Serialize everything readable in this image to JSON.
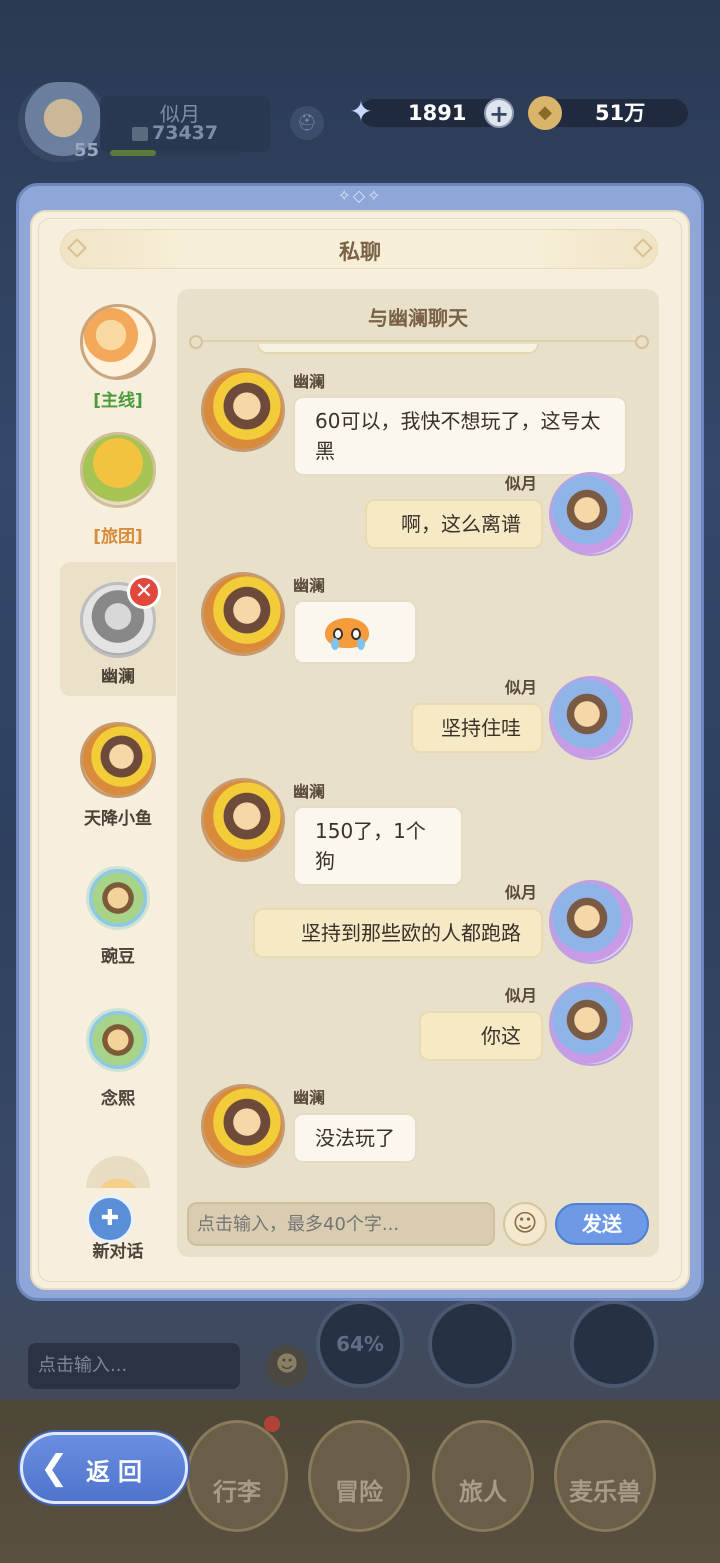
{
  "hud": {
    "player_name": "似月",
    "power": "73437",
    "level": "55",
    "exp_fraction": 0.35,
    "gems": "1891",
    "coins": "51万"
  },
  "dialog": {
    "title": "私聊",
    "chat_title": "与幽澜聊天"
  },
  "contacts": [
    {
      "label": "[主线]"
    },
    {
      "label": "[旅团]"
    },
    {
      "label": "幽澜"
    },
    {
      "label": "天降小鱼"
    },
    {
      "label": "豌豆"
    },
    {
      "label": "念熙"
    }
  ],
  "new_chat_label": "新对话",
  "messages": [
    {
      "sender": "幽澜",
      "text": "60可以，我快不想玩了，这号太黑"
    },
    {
      "sender": "似月",
      "text": "啊，这么离谱"
    },
    {
      "sender": "幽澜",
      "text": ""
    },
    {
      "sender": "似月",
      "text": "坚持住哇"
    },
    {
      "sender": "幽澜",
      "text": "150了，1个狗"
    },
    {
      "sender": "似月",
      "text": "坚持到那些欧的人都跑路"
    },
    {
      "sender": "似月",
      "text": "你这"
    },
    {
      "sender": "幽澜",
      "text": "没法玩了"
    }
  ],
  "input": {
    "placeholder": "点击输入，最多40个字..."
  },
  "send_label": "发送",
  "background": {
    "skill_percent": "64%",
    "input_placeholder": "点击输入...",
    "nav_tabs": [
      "行李",
      "冒险",
      "旅人",
      "麦乐兽"
    ]
  },
  "back_label": "返回",
  "colors": {
    "send_button": "#6d99e6",
    "close_badge": "#e0483c",
    "contact_main": "#4a9a3a",
    "contact_team": "#d98b3a"
  }
}
